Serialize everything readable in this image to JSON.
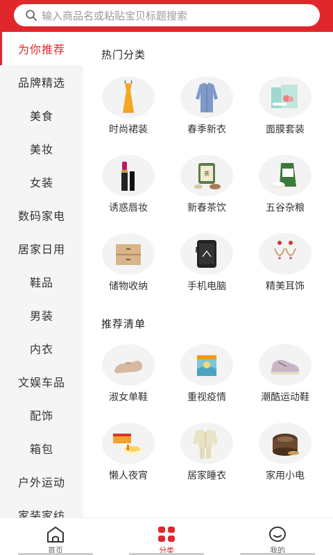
{
  "search": {
    "placeholder": "输入商品名或粘贴宝贝标题搜索",
    "icon": "search-icon"
  },
  "sidebar": {
    "active_index": 0,
    "items": [
      {
        "label": "为你推荐"
      },
      {
        "label": "品牌精选"
      },
      {
        "label": "美食"
      },
      {
        "label": "美妆"
      },
      {
        "label": "女装"
      },
      {
        "label": "数码家电"
      },
      {
        "label": "居家日用"
      },
      {
        "label": "鞋品"
      },
      {
        "label": "男装"
      },
      {
        "label": "内衣"
      },
      {
        "label": "文娱车品"
      },
      {
        "label": "配饰"
      },
      {
        "label": "箱包"
      },
      {
        "label": "户外运动"
      },
      {
        "label": "家装家纺"
      }
    ]
  },
  "hot": {
    "title": "热门分类",
    "items": [
      {
        "label": "时尚裙装",
        "icon": "dress-icon"
      },
      {
        "label": "春季新衣",
        "icon": "shirt-icon"
      },
      {
        "label": "面膜套装",
        "icon": "mask-box-icon"
      },
      {
        "label": "诱惑唇妆",
        "icon": "lipstick-icon"
      },
      {
        "label": "新春茶饮",
        "icon": "tea-can-icon"
      },
      {
        "label": "五谷杂粮",
        "icon": "rice-bag-icon"
      },
      {
        "label": "储物收纳",
        "icon": "drawer-icon"
      },
      {
        "label": "手机电脑",
        "icon": "phone-icon"
      },
      {
        "label": "精美耳饰",
        "icon": "earring-icon"
      }
    ]
  },
  "recommend": {
    "title": "推荐清单",
    "items": [
      {
        "label": "淑女单鞋",
        "icon": "flat-shoe-icon"
      },
      {
        "label": "重视疫情",
        "icon": "face-mask-icon"
      },
      {
        "label": "潮酷运动鞋",
        "icon": "sneaker-icon"
      },
      {
        "label": "懒人夜宵",
        "icon": "noodle-icon"
      },
      {
        "label": "居家睡衣",
        "icon": "pajamas-icon"
      },
      {
        "label": "家用小电",
        "icon": "rice-cooker-icon"
      }
    ]
  },
  "tabbar": {
    "active_index": 1,
    "tabs": [
      {
        "label": "首页",
        "icon": "home-icon"
      },
      {
        "label": "分类",
        "icon": "category-icon"
      },
      {
        "label": "我的",
        "icon": "profile-icon"
      }
    ]
  },
  "colors": {
    "accent": "#e0272c",
    "sidebar_bg": "#f5f5f5",
    "circle_bg": "#f3f3f3"
  }
}
